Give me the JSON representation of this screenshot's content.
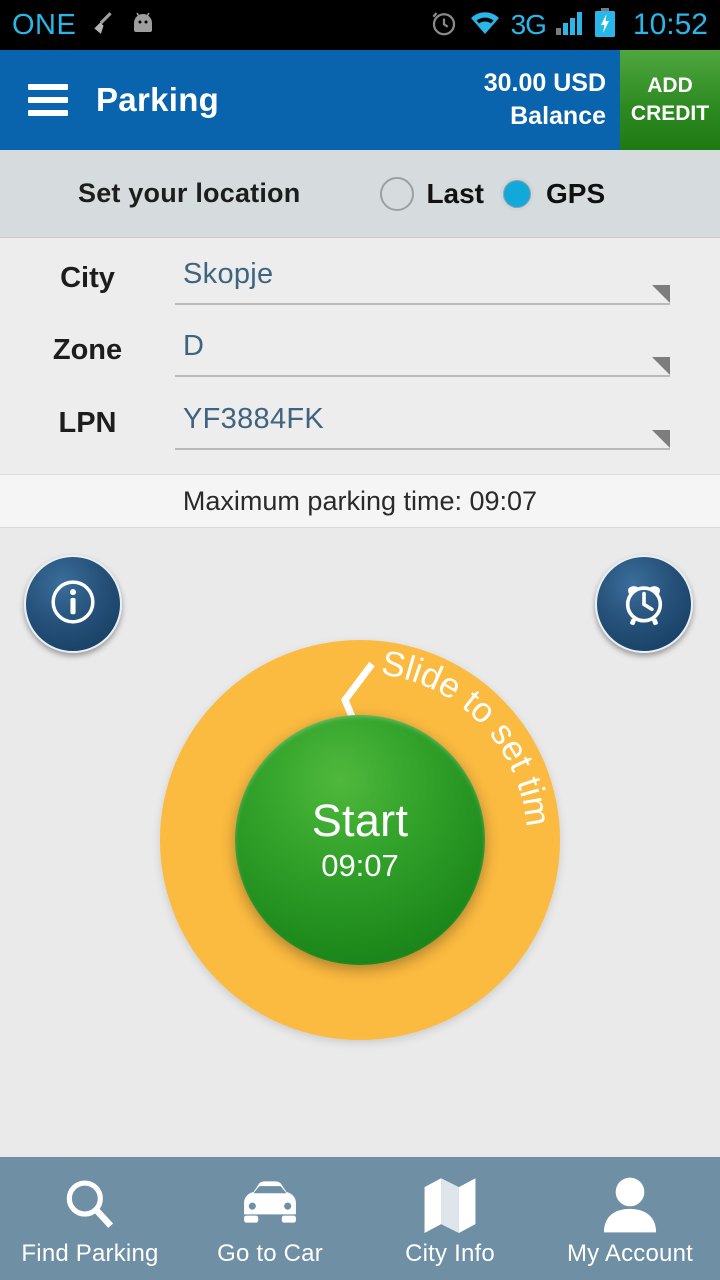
{
  "statusbar": {
    "carrier": "ONE",
    "network": "3G",
    "time": "10:52",
    "icons": [
      "broom-icon",
      "android-icon",
      "alarm-icon",
      "wifi-icon",
      "signal-icon",
      "battery-charging-icon"
    ]
  },
  "appbar": {
    "menu_icon": "hamburger-menu-icon",
    "title": "Parking",
    "balance_amount": "30.00 USD",
    "balance_label": "Balance",
    "add_credit_line1": "ADD",
    "add_credit_line2": "CREDIT",
    "bar_color": "#0A63AD",
    "add_credit_color": "#2E8B22"
  },
  "location": {
    "label": "Set your location",
    "options": [
      {
        "label": "Last",
        "selected": false
      },
      {
        "label": "GPS",
        "selected": true
      }
    ],
    "selected_color": "#11A9DA"
  },
  "form": {
    "fields": [
      {
        "label": "City",
        "value": "Skopje"
      },
      {
        "label": "Zone",
        "value": "D"
      },
      {
        "label": "LPN",
        "value": "YF3884FK"
      }
    ],
    "value_color": "#3F6480"
  },
  "max_time": {
    "text": "Maximum parking time: 09:07"
  },
  "dial": {
    "info_icon": "info-icon",
    "alarm_icon": "alarm-clock-icon",
    "ring_hint": "Slide to set time",
    "ring_color": "#FBBA40",
    "start_label": "Start",
    "start_time": "09:07",
    "start_color": "#2E9B28"
  },
  "bottomnav": {
    "bg_color": "#6F8FA5",
    "items": [
      {
        "label": "Find Parking",
        "icon": "search-icon"
      },
      {
        "label": "Go to Car",
        "icon": "car-icon"
      },
      {
        "label": "City Info",
        "icon": "map-icon"
      },
      {
        "label": "My Account",
        "icon": "person-icon"
      }
    ]
  }
}
